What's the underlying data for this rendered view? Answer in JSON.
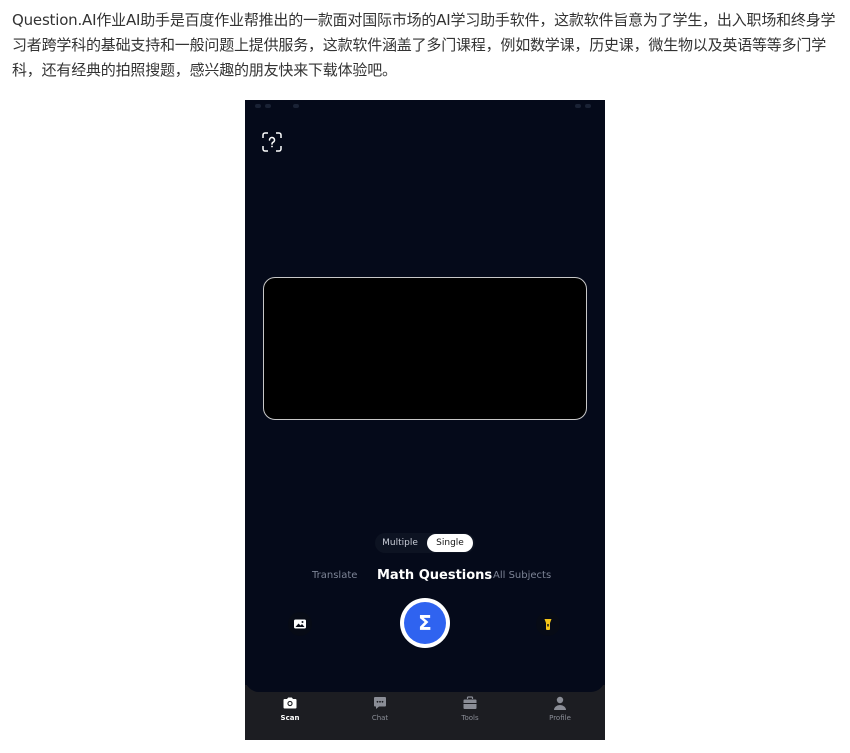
{
  "article": {
    "intro": "Question.AI作业AI助手是百度作业帮推出的一款面对国际市场的AI学习助手软件，这款软件旨意为了学生，出入职场和终身学习者跨学科的基础支持和一般问题上提供服务，这款软件涵盖了多门课程，例如数学课，历史课，微生物以及英语等等多门学科，还有经典的拍照搜题，感兴趣的朋友快来下载体验吧。"
  },
  "app": {
    "mode_toggle": {
      "multiple_label": "Multiple",
      "single_label": "Single",
      "selected": "Single"
    },
    "subject_tabs": {
      "translate_label": "Translate",
      "math_label": "Math Questions",
      "all_label": "All Subjects",
      "selected": "Math Questions"
    },
    "shutter_symbol": "Σ",
    "tab_bar": {
      "items": [
        {
          "label": "Scan",
          "icon": "camera-icon",
          "active": true
        },
        {
          "label": "Chat",
          "icon": "chat-icon",
          "active": false
        },
        {
          "label": "Tools",
          "icon": "toolbox-icon",
          "active": false
        },
        {
          "label": "Profile",
          "icon": "person-icon",
          "active": false
        }
      ]
    },
    "icons": {
      "help": "help-scan-icon",
      "gallery": "image-icon",
      "flash": "flashlight-icon"
    },
    "colors": {
      "background": "#050a1a",
      "accent": "#2f63f0",
      "flash": "#f5c518",
      "tab_bar": "#1c1d22"
    }
  }
}
